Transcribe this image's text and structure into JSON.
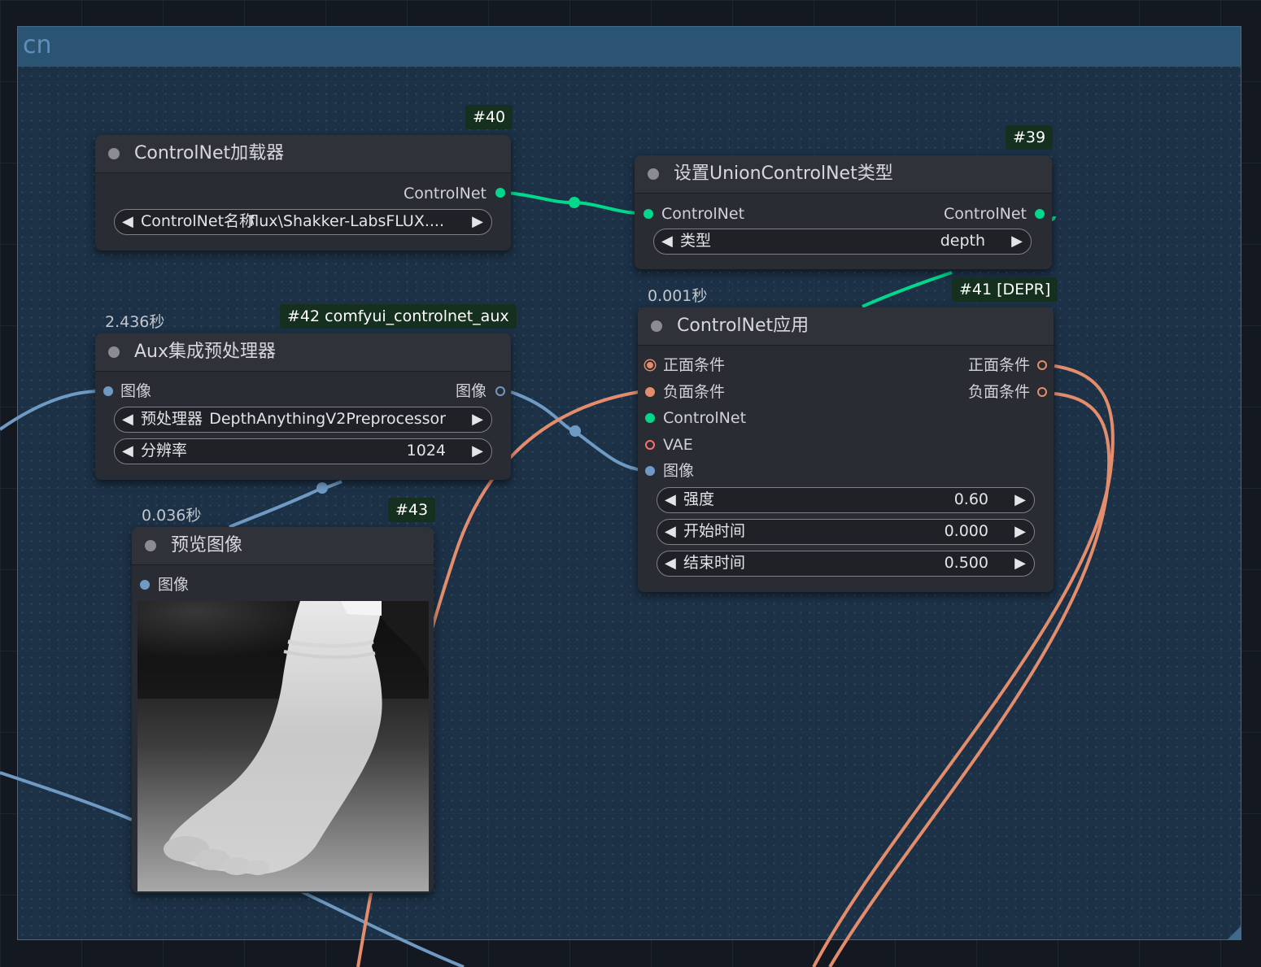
{
  "group": {
    "title": "cn"
  },
  "colors": {
    "controlnet_wire": "#00d98b",
    "conditioning_wire": "#e48d6d",
    "image_wire": "#6f9ac4",
    "vae_port": "#ff6e6e"
  },
  "node40": {
    "badge": "#40",
    "title": "ControlNet加载器",
    "output": "ControlNet",
    "widget_label": "ControlNet名称",
    "widget_value": "flux\\Shakker-LabsFLUX...."
  },
  "node39": {
    "badge": "#39",
    "title": "设置UnionControlNet类型",
    "input": "ControlNet",
    "output": "ControlNet",
    "widget_label": "类型",
    "widget_value": "depth"
  },
  "node42": {
    "timing": "2.436秒",
    "badge": "#42 comfyui_controlnet_aux",
    "title": "Aux集成预处理器",
    "input": "图像",
    "output": "图像",
    "w1_label": "预处理器",
    "w1_value": "DepthAnythingV2Preprocessor",
    "w2_label": "分辨率",
    "w2_value": "1024"
  },
  "node41": {
    "timing": "0.001秒",
    "badge": "#41 [DEPR]",
    "title": "ControlNet应用",
    "in_positive": "正面条件",
    "in_negative": "负面条件",
    "in_controlnet": "ControlNet",
    "in_vae": "VAE",
    "in_image": "图像",
    "out_positive": "正面条件",
    "out_negative": "负面条件",
    "w_strength_label": "强度",
    "w_strength_value": "0.60",
    "w_start_label": "开始时间",
    "w_start_value": "0.000",
    "w_end_label": "结束时间",
    "w_end_value": "0.500"
  },
  "node43": {
    "timing": "0.036秒",
    "badge": "#43",
    "title": "预览图像",
    "input": "图像"
  },
  "arrow_left": "◀",
  "arrow_right": "▶"
}
